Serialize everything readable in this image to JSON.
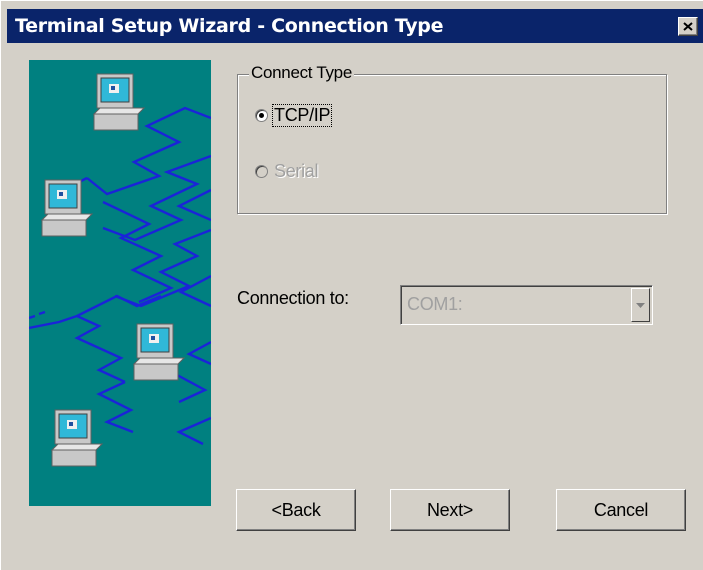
{
  "window": {
    "title": "Terminal Setup Wizard - Connection Type"
  },
  "titlebar": {
    "close_icon": "close-icon",
    "close_glyph": "✕"
  },
  "art": {
    "description_icon": "network-computers-illustration"
  },
  "connect_type": {
    "legend": "Connect Type",
    "options": [
      {
        "label": "TCP/IP",
        "checked": true,
        "enabled": true,
        "focused": true
      },
      {
        "label": "Serial",
        "checked": false,
        "enabled": false,
        "focused": false
      }
    ]
  },
  "connection": {
    "label": "Connection to:",
    "value": "COM1:",
    "enabled": false,
    "arrow_icon": "chevron-down-icon"
  },
  "buttons": {
    "back_label": "<Back",
    "next_label": "Next>",
    "cancel_label": "Cancel"
  },
  "colors": {
    "titlebar": "#0a246a",
    "face": "#d4d0c8",
    "art_background": "#008080",
    "network_line": "#1a24d8",
    "disabled_text": "#a0a0a0"
  }
}
